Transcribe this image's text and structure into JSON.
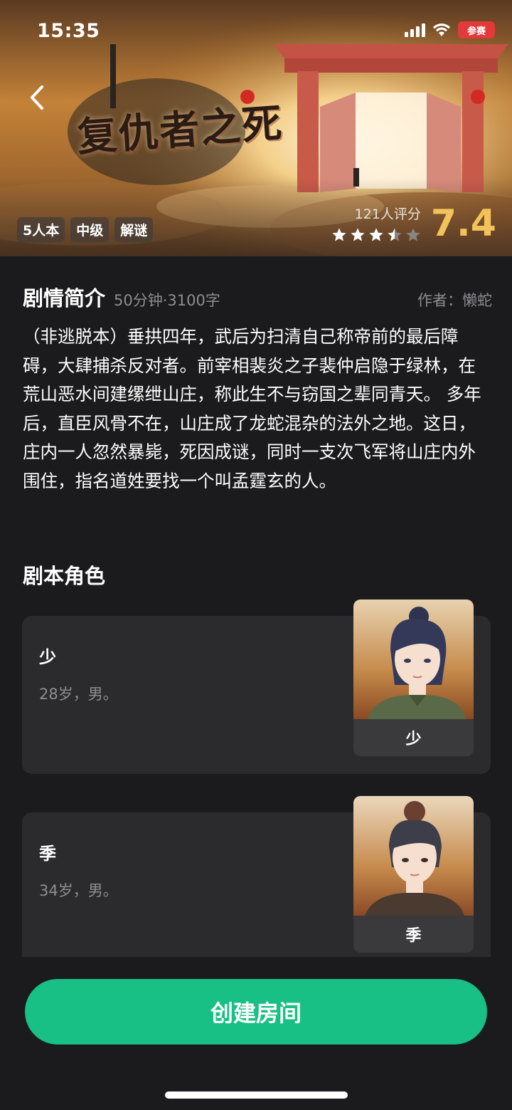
{
  "status_bar": {
    "time": "15:35",
    "battery_badge": "参赛",
    "signal_icon": "cellular-signal-icon",
    "wifi_icon": "wifi-icon"
  },
  "hero": {
    "logo_text": "复仇者之死",
    "back_icon": "chevron-left-icon",
    "tags": [
      "5人本",
      "中级",
      "解谜"
    ],
    "rating_count": "121人评分",
    "stars_filled": 3.5,
    "stars_total": 5,
    "score": "7.4",
    "colors": {
      "score": "#f2c35a",
      "star_on": "#ffffff",
      "star_off": "#8a8580"
    }
  },
  "intro": {
    "title": "剧情简介",
    "meta": "50分钟·3100字",
    "author": "作者：懒蛇",
    "synopsis": "（非逃脱本）垂拱四年，武后为扫清自己称帝前的最后障碍，大肆捕杀反对者。前宰相裴炎之子裴仲启隐于绿林，在荒山恶水间建缧绁山庄，称此生不与窃国之辈同青天。 多年后，直臣风骨不在，山庄成了龙蛇混杂的法外之地。这日，庄内一人忽然暴毙，死因成谜，同时一支次飞军将山庄内外围住，指名道姓要找一个叫孟霆玄的人。"
  },
  "roles": {
    "title": "剧本角色",
    "items": [
      {
        "name": "少",
        "desc": "28岁，男。",
        "portrait_label": "少"
      },
      {
        "name": "季",
        "desc": "34岁，男。",
        "portrait_label": "季"
      }
    ]
  },
  "actions": {
    "create_room": "创建房间",
    "accent": "#18c086"
  }
}
